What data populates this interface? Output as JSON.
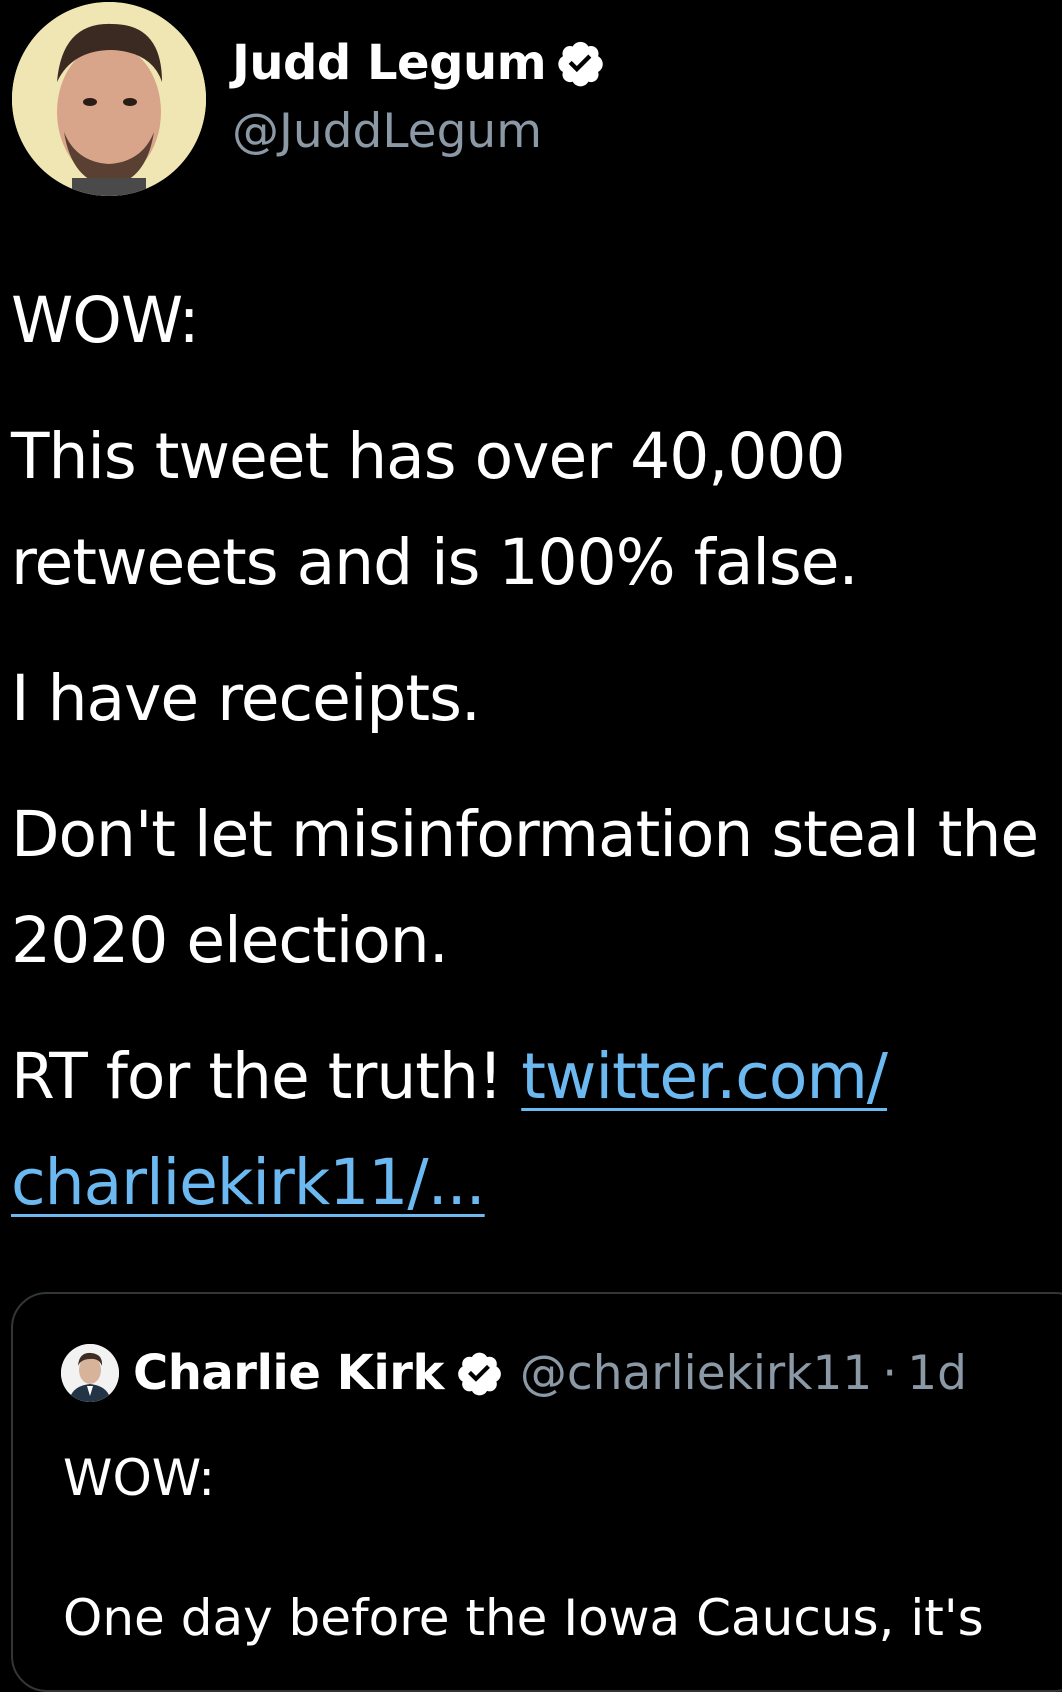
{
  "tweet": {
    "author": {
      "name": "Judd Legum",
      "handle": "@JuddLegum",
      "verified": true
    },
    "body": {
      "p1": "WOW:",
      "p2_line1": "This tweet has over 40,000",
      "p2_line2": "retweets and is 100% false.",
      "p3": "I have receipts.",
      "p4_line1": "Don't let misinformation steal the",
      "p4_line2": "2020 election.",
      "p5_text": "RT for the truth! ",
      "p5_link_line1": "twitter.com/",
      "p5_link_line2": "charliekirk11/..."
    }
  },
  "quoted_tweet": {
    "author_name": "Charlie Kirk",
    "handle": "@charliekirk11",
    "separator": "·",
    "time": "1d",
    "text_line1": "WOW:",
    "text_line2": "One day before the Iowa Caucus, it's"
  },
  "colors": {
    "background": "#000000",
    "text": "#ffffff",
    "secondary": "#8b98a5",
    "link": "#6bb9f0",
    "border": "#333639"
  },
  "icons": {
    "verified": "verified-badge-icon",
    "avatar": "avatar"
  }
}
